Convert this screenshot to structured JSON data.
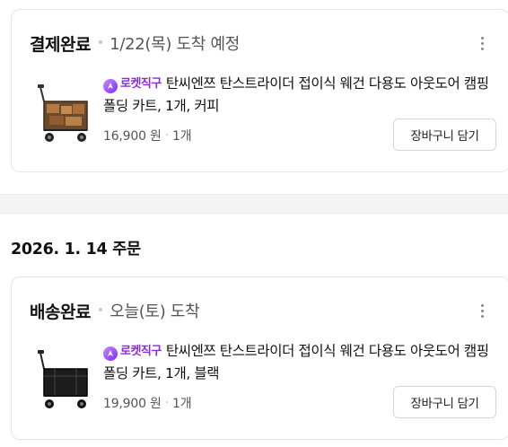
{
  "orders": [
    {
      "status": "결제완료",
      "eta": "1/22(목) 도착 예정",
      "badge": "로켓직구",
      "product_title": "탄씨엔쯔 탄스트라이더 접이식 웨건 다용도 아웃도어 캠핑 폴딩 카트, 1개, 커피",
      "price": "16,900 원",
      "quantity": "1개",
      "cart_button": "장바구니 담기",
      "thumbnail_icon": "folding-wagon-coffee"
    },
    {
      "status": "배송완료",
      "eta": "오늘(토) 도착",
      "badge": "로켓직구",
      "product_title": "탄씨엔쯔 탄스트라이더 접이식 웨건 다용도 아웃도어 캠핑 폴딩 카트, 1개, 블랙",
      "price": "19,900 원",
      "quantity": "1개",
      "cart_button": "장바구니 담기",
      "thumbnail_icon": "folding-wagon-black"
    }
  ],
  "order_group_date": "2026. 1. 14 주문",
  "icons": {
    "more": "more-vertical-icon",
    "rocket": "rocket-direct-icon"
  },
  "colors": {
    "badge": "#8a2be2",
    "status_text": "#111111",
    "muted_text": "#555555"
  }
}
